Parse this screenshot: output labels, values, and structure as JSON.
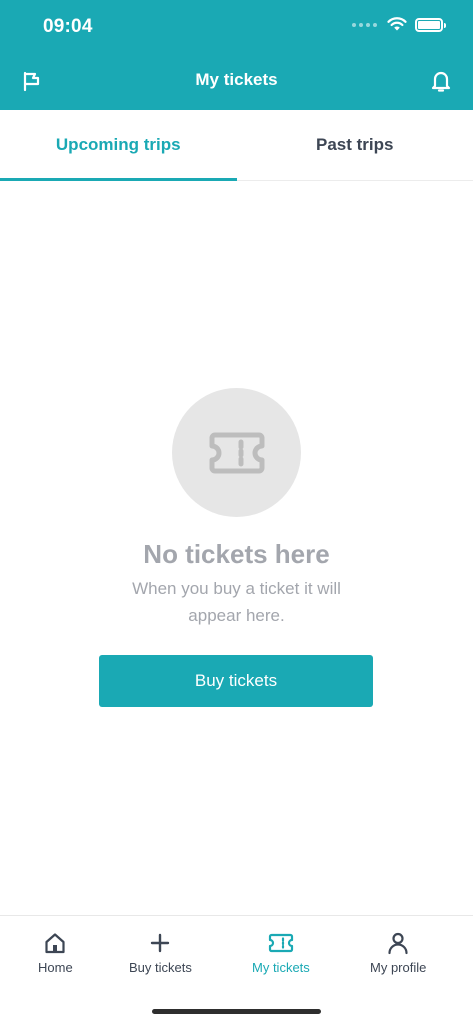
{
  "status_bar": {
    "time": "09:04"
  },
  "header": {
    "title": "My tickets",
    "left_icon": "flag-icon",
    "right_icon": "bell-icon"
  },
  "tabs": [
    {
      "label": "Upcoming trips",
      "active": true
    },
    {
      "label": "Past trips",
      "active": false
    }
  ],
  "empty_state": {
    "icon": "ticket-icon",
    "title": "No tickets here",
    "description": "When you buy a ticket it will appear here.",
    "button_label": "Buy tickets"
  },
  "bottom_nav": {
    "items": [
      {
        "label": "Home",
        "icon": "home-icon",
        "active": false
      },
      {
        "label": "Buy tickets",
        "icon": "plus-icon",
        "active": false
      },
      {
        "label": "My tickets",
        "icon": "ticket-icon",
        "active": true
      },
      {
        "label": "My profile",
        "icon": "user-icon",
        "active": false
      }
    ]
  },
  "colors": {
    "primary": "#1aa9b4",
    "text_dark": "#3d4654",
    "text_muted": "#a3a6ad",
    "placeholder_circle": "#e6e6e6"
  }
}
